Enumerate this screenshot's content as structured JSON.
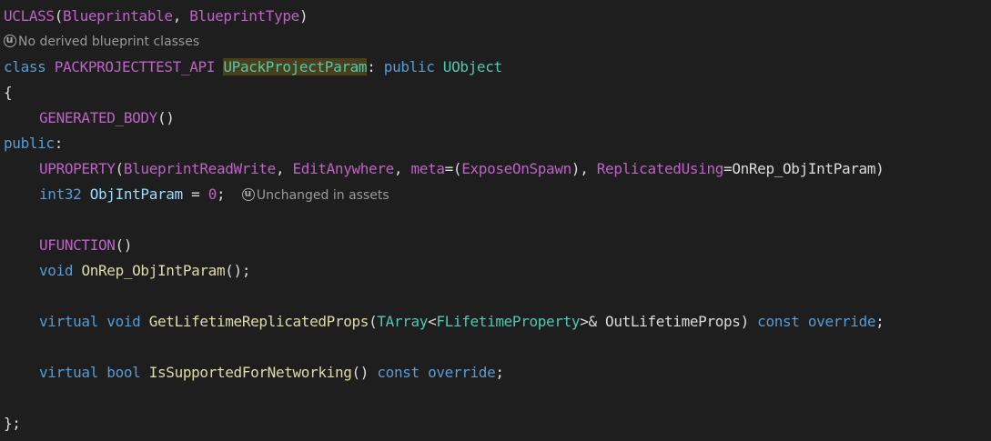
{
  "colors": {
    "background": "#1e1e1e",
    "macro": "#bd63c5",
    "keyword": "#569cd6",
    "type": "#4ec9b0",
    "function": "#dcdcaa",
    "variable": "#9cdcfe",
    "number": "#b5cea8",
    "plain": "#dcdcdc",
    "hint": "#9a9a9a",
    "highlight": "#4a3f1a"
  },
  "code": {
    "l1": {
      "macro": "UCLASS",
      "open": "(",
      "arg1": "Blueprintable",
      "sep": ", ",
      "arg2": "BlueprintType",
      "close": ")"
    },
    "hint1": {
      "icon": "unreal-engine-icon",
      "text": "No derived blueprint classes"
    },
    "l2": {
      "kw_class": "class",
      "api": "PACKPROJECTTEST_API",
      "name": "UPackProjectParam",
      "colon": ": ",
      "kw_public": "public",
      "base": "UObject"
    },
    "l3": {
      "brace": "{"
    },
    "l4": {
      "macro": "GENERATED_BODY",
      "parens": "()"
    },
    "l5": {
      "kw_public": "public",
      "colon": ":"
    },
    "l6": {
      "macro": "UPROPERTY",
      "open": "(",
      "arg1": "BlueprintReadWrite",
      "sep1": ", ",
      "arg2": "EditAnywhere",
      "sep2": ", ",
      "arg3": "meta",
      "eq1": "=(",
      "arg4": "ExposeOnSpawn",
      "close1": "), ",
      "arg5": "ReplicatedUsing",
      "eq2": "=",
      "arg6": "OnRep_ObjIntParam",
      "close2": ")"
    },
    "l7": {
      "type": "int32",
      "var": "ObjIntParam",
      "eq": " = ",
      "num": "0",
      "semi": ";",
      "hint_icon": "unreal-engine-icon",
      "hint": "Unchanged in assets"
    },
    "l8": {
      "macro": "UFUNCTION",
      "parens": "()"
    },
    "l9": {
      "kw_void": "void",
      "fn": "OnRep_ObjIntParam",
      "rest": "();"
    },
    "l10": {
      "kw_virtual": "virtual",
      "kw_void": "void",
      "fn": "GetLifetimeReplicatedProps",
      "open": "(",
      "tarray": "TArray",
      "lt": "<",
      "ftype": "FLifetimeProperty",
      "gt_ref": ">& ",
      "param": "OutLifetimeProps",
      "close": ") ",
      "kw_const": "const",
      "kw_override": "override",
      "semi": ";"
    },
    "l11": {
      "kw_virtual": "virtual",
      "kw_bool": "bool",
      "fn": "IsSupportedForNetworking",
      "parens": "() ",
      "kw_const": "const",
      "kw_override": "override",
      "semi": ";"
    },
    "l12": {
      "brace": "};"
    }
  }
}
